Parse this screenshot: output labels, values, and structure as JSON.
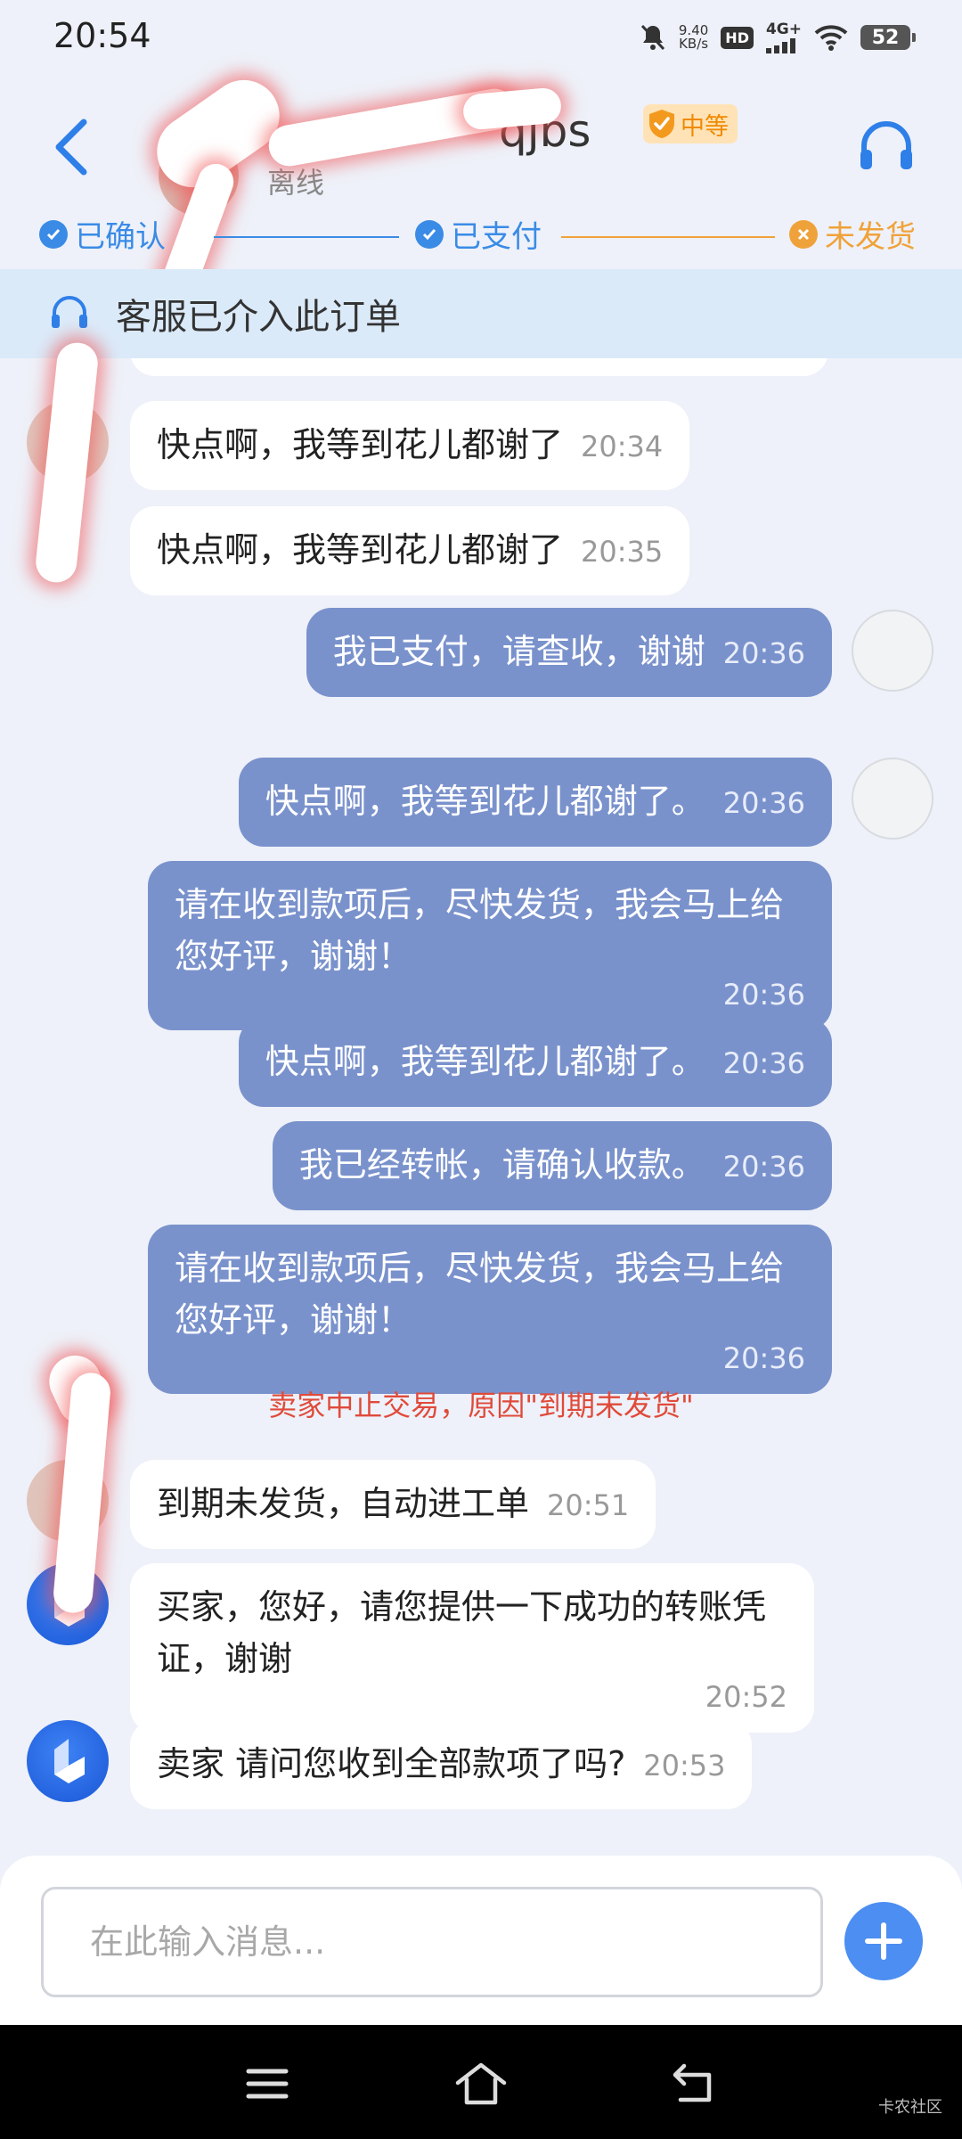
{
  "status_bar": {
    "time": "20:54",
    "net_speed_value": "9.40",
    "net_speed_unit": "KB/s",
    "hd": "HD",
    "signal": "4G+",
    "battery": "52"
  },
  "header": {
    "name_suffix": "qjbs",
    "level": "中等",
    "status": "离线"
  },
  "steps": [
    {
      "label": "已确认",
      "state": "done",
      "color": "#3a8be6"
    },
    {
      "label": "已支付",
      "state": "done",
      "color": "#3a8be6"
    },
    {
      "label": "未发货",
      "state": "pending",
      "color": "#f0a23a"
    }
  ],
  "banner": {
    "text": "客服已介入此订单"
  },
  "messages": [
    {
      "side": "in",
      "from": "seller",
      "text": "快点啊，我等到花儿都谢了",
      "time": "20:34"
    },
    {
      "side": "in",
      "from": "seller",
      "text": "快点啊，我等到花儿都谢了",
      "time": "20:35"
    },
    {
      "side": "out",
      "text": "我已支付，请查收，谢谢",
      "time": "20:36"
    },
    {
      "side": "out",
      "text": "快点啊，我等到花儿都谢了。",
      "time": "20:36"
    },
    {
      "side": "out",
      "text": "请在收到款项后，尽快发货，我会马上给您好评，谢谢！",
      "time": "20:36"
    },
    {
      "side": "out",
      "text": "快点啊，我等到花儿都谢了。",
      "time": "20:36"
    },
    {
      "side": "out",
      "text": "我已经转帐，请确认收款。",
      "time": "20:36"
    },
    {
      "side": "out",
      "text": "请在收到款项后，尽快发货，我会马上给您好评，谢谢！",
      "time": "20:36"
    },
    {
      "side": "in",
      "from": "seller",
      "text": "到期未发货，自动进工单",
      "time": "20:51"
    },
    {
      "side": "in",
      "from": "service",
      "text": "买家，您好，请您提供一下成功的转账凭证，谢谢",
      "time": "20:52"
    },
    {
      "side": "in",
      "from": "service",
      "text": "卖家 请问您收到全部款项了吗?",
      "time": "20:53"
    }
  ],
  "system_message": "卖家中止交易，原因\"到期未发货\"",
  "input": {
    "placeholder": "在此输入消息..."
  },
  "watermark": "卡农社区",
  "colors": {
    "accent": "#3a8be6",
    "outgoing_bubble": "#7a92cc",
    "warning": "#f0a23a",
    "system_text": "#e04a3a"
  }
}
